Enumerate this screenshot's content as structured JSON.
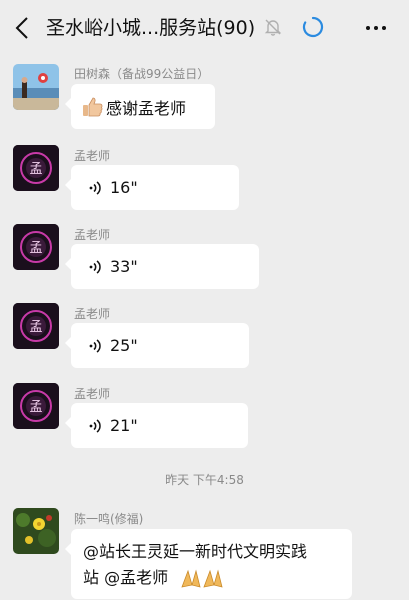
{
  "header": {
    "title": "圣水峪小城...服务站(90)"
  },
  "messages": [
    {
      "sender": "田树森（备战99公益日）",
      "text": "感谢孟老师"
    },
    {
      "sender": "孟老师",
      "duration": "16\""
    },
    {
      "sender": "孟老师",
      "duration": "33\""
    },
    {
      "sender": "孟老师",
      "duration": "25\""
    },
    {
      "sender": "孟老师",
      "duration": "21\""
    }
  ],
  "timestamp": "昨天 下午4:58",
  "last_message": {
    "sender": "陈一鸣(修福)",
    "line1": "@站长王灵延一新时代文明实践",
    "line2": "站 @孟老师"
  },
  "avatar_logo_text": "孟",
  "colors": {
    "background": "#ededed",
    "bubble": "#ffffff",
    "loading_ring": "#2b8be0"
  }
}
